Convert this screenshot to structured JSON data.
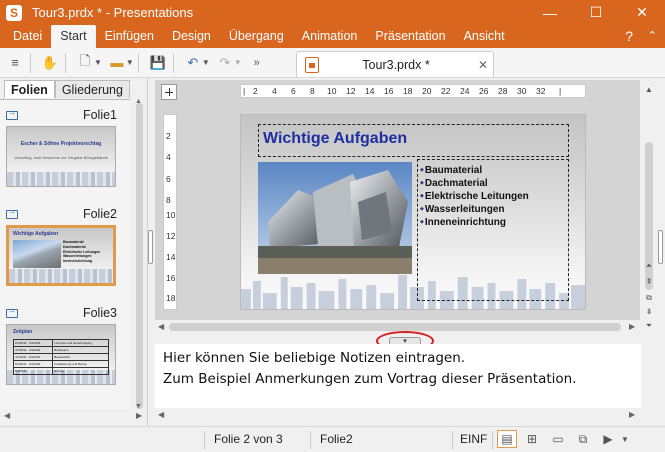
{
  "window": {
    "title": "Tour3.prdx * - Presentations",
    "app_icon_letter": "S",
    "minimize": "—",
    "maximize": "☐",
    "close": "✕"
  },
  "menu": {
    "items": [
      "Datei",
      "Start",
      "Einfügen",
      "Design",
      "Übergang",
      "Animation",
      "Präsentation",
      "Ansicht"
    ],
    "active": "Start",
    "help": "?",
    "collapse": "⌃"
  },
  "toolbar": {
    "document_tab": "Tour3.prdx *",
    "tab_close": "✕",
    "overflow": "»"
  },
  "left_panel": {
    "tabs": [
      "Folien",
      "Gliederung"
    ],
    "active_tab": "Folien",
    "slides": [
      {
        "label": "Folie1",
        "title": "Escher & Söhne Projektvorschlag",
        "subtitle": "Vorschlag Josh Newsome zur Vergabe Bürogebäude"
      },
      {
        "label": "Folie2",
        "title": "Wichtige Aufgaben",
        "items": [
          "Baumaterial",
          "Dachmaterial",
          "Elektrische Leitungen",
          "Wasserleitungen",
          "Inneneinrichtung"
        ]
      },
      {
        "label": "Folie3",
        "title": "Zeitplan",
        "rows": [
          [
            "2/1/2011 - 3/1/2011",
            "Lizenzen und Genehmigung"
          ],
          [
            "3/1/2011 - 4/1/2011",
            "Baubeginn"
          ],
          [
            "4/1/2011 - 5/1/2011",
            "Bauaufsicht"
          ],
          [
            "5/1/2011 - 6/1/2011",
            "Finalisierung und Bezug"
          ],
          [
            "6/1/2011",
            "Einzug"
          ]
        ]
      }
    ]
  },
  "editor": {
    "ruler_h": [
      "2",
      "4",
      "6",
      "8",
      "10",
      "12",
      "14",
      "16",
      "18",
      "20",
      "22",
      "24",
      "26",
      "28",
      "30",
      "32"
    ],
    "ruler_v": [
      "2",
      "4",
      "6",
      "8",
      "10",
      "12",
      "14",
      "16",
      "18"
    ],
    "slide": {
      "title": "Wichtige Aufgaben",
      "bullets": [
        "Baumaterial",
        "Dachmaterial",
        "Elektrische Leitungen",
        "Wasserleitungen",
        "Inneneinrichtung"
      ]
    }
  },
  "notes": {
    "lines": [
      "Hier können Sie beliebige Notizen eintragen.",
      "Zum Beispiel Anmerkungen zum Vortrag dieser Präsentation."
    ]
  },
  "statusbar": {
    "slide_position": "Folie 2 von 3",
    "slide_name": "Folie2",
    "mode": "EINF"
  },
  "colors": {
    "brand": "#d9661f",
    "slide_title": "#1e2fa0",
    "selection": "#e19a4a",
    "highlight_circle": "#d82020"
  }
}
